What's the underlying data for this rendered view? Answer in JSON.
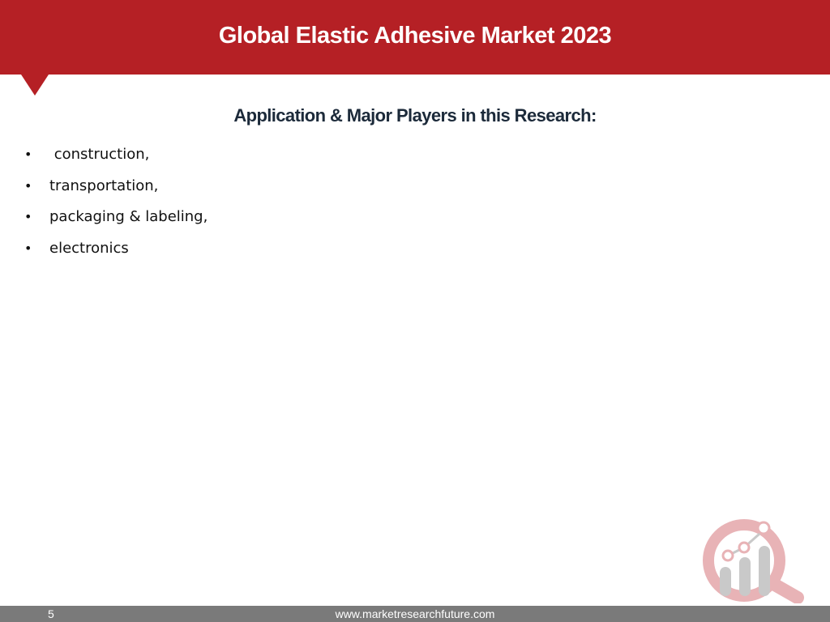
{
  "header": {
    "title": "Global Elastic Adhesive Market 2023",
    "color": "#b52025"
  },
  "section": {
    "heading": "Application & Major Players in this Research",
    "heading_suffix": ":"
  },
  "applications": {
    "items": [
      {
        "bullet": "•",
        "label": " construction,"
      },
      {
        "bullet": "•",
        "label": "transportation,"
      },
      {
        "bullet": "•",
        "label": "packaging & labeling,"
      },
      {
        "bullet": "•",
        "label": "electronics"
      }
    ]
  },
  "logo": {
    "icon": "magnifier-bar-chart-icon",
    "colors": {
      "ring": "#e8b3b6",
      "bars": "#c9c9c9"
    }
  },
  "footer": {
    "page_number": "5",
    "url": "www.marketresearchfuture.com",
    "color": "#7a7a7a"
  }
}
